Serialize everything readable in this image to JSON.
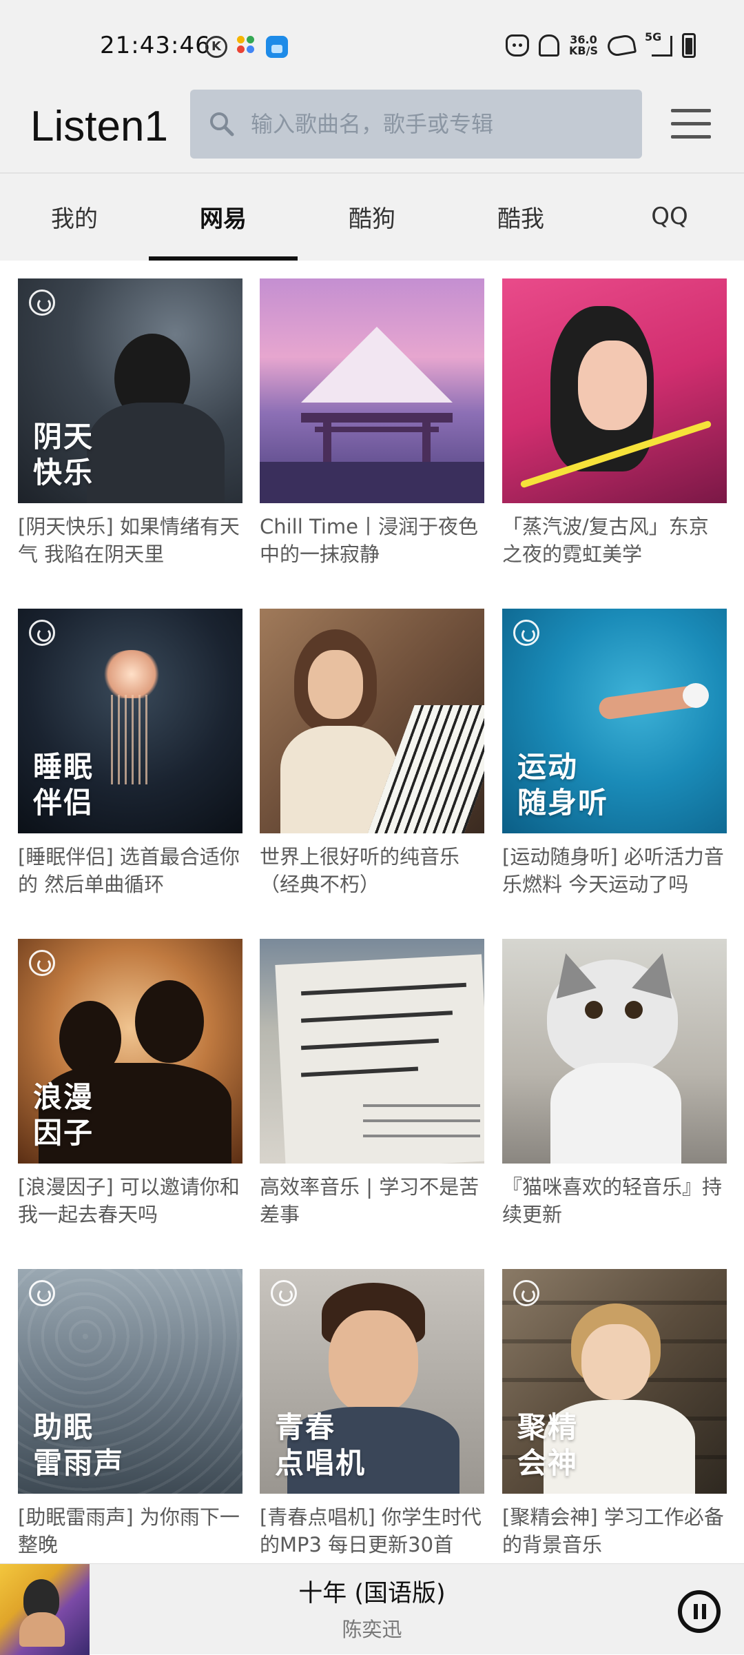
{
  "status_bar": {
    "time": "21:43:46",
    "k_label": "K",
    "speed_top": "36.0",
    "speed_bottom": "KB/S",
    "network": "5G"
  },
  "header": {
    "title": "Listen1",
    "search_placeholder": "输入歌曲名，歌手或专辑"
  },
  "tabs": [
    {
      "label": "我的",
      "active": false
    },
    {
      "label": "网易",
      "active": true
    },
    {
      "label": "酷狗",
      "active": false
    },
    {
      "label": "酷我",
      "active": false
    },
    {
      "label": "QQ",
      "active": false
    }
  ],
  "playlists": [
    {
      "caption": "[阴天快乐] 如果情绪有天气 我陷在阴天里",
      "overlay": "阴天\n快乐",
      "badge": true
    },
    {
      "caption": "Chill Time丨浸润于夜色中的一抹寂静",
      "overlay": "",
      "badge": false
    },
    {
      "caption": "「蒸汽波/复古风」东京之夜的霓虹美学",
      "overlay": "",
      "badge": false
    },
    {
      "caption": "[睡眠伴侣] 选首最合适你的 然后单曲循环",
      "overlay": "睡眠\n伴侣",
      "badge": true
    },
    {
      "caption": "世界上很好听的纯音乐（经典不朽）",
      "overlay": "",
      "badge": false
    },
    {
      "caption": "[运动随身听] 必听活力音乐燃料 今天运动了吗",
      "overlay": "运动\n随身听",
      "badge": true
    },
    {
      "caption": "[浪漫因子] 可以邀请你和我一起去春天吗",
      "overlay": "浪漫\n因子",
      "badge": true
    },
    {
      "caption": "高效率音乐 | 学习不是苦差事",
      "overlay": "",
      "badge": false
    },
    {
      "caption": "『猫咪喜欢的轻音乐』持续更新",
      "overlay": "",
      "badge": false
    },
    {
      "caption": "[助眠雷雨声] 为你雨下一整晚",
      "overlay": "助眠\n雷雨声",
      "badge": true
    },
    {
      "caption": "[青春点唱机] 你学生时代的MP3 每日更新30首",
      "overlay": "青春\n点唱机",
      "badge": true
    },
    {
      "caption": "[聚精会神] 学习工作必备的背景音乐",
      "overlay": "聚精\n会神",
      "badge": true
    }
  ],
  "player": {
    "title": "十年 (国语版)",
    "artist": "陈奕迅",
    "state": "playing"
  },
  "colors": {
    "header_bg": "#f1f1f1",
    "search_bg": "#c3cad3",
    "tab_indicator": "#111111",
    "caption_text": "#5a5a5a"
  }
}
